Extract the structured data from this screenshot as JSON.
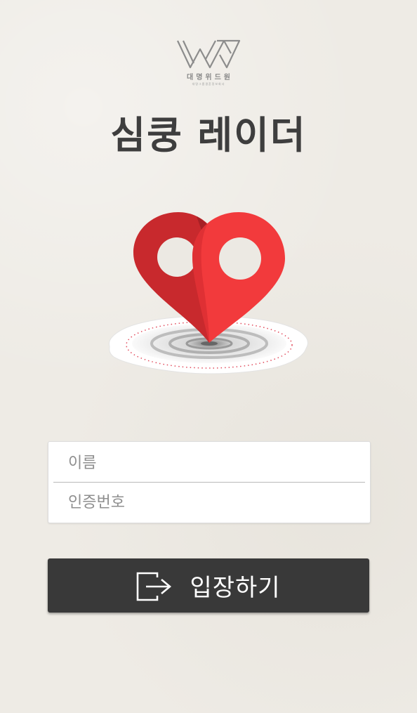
{
  "logo": {
    "name": "대명위드원",
    "subtitle": "대명그룹결혼정보회사"
  },
  "app_title": "심쿵 레이더",
  "hero": {
    "icon": "heart-location-pin-icon",
    "colors": {
      "left": "#c8292d",
      "right": "#f23a3c",
      "base": "#ffffff"
    }
  },
  "form": {
    "name_placeholder": "이름",
    "code_placeholder": "인증번호",
    "name_value": "",
    "code_value": ""
  },
  "enter_button": {
    "label": "입장하기",
    "icon": "enter-arrow-icon",
    "color": "#393939"
  }
}
